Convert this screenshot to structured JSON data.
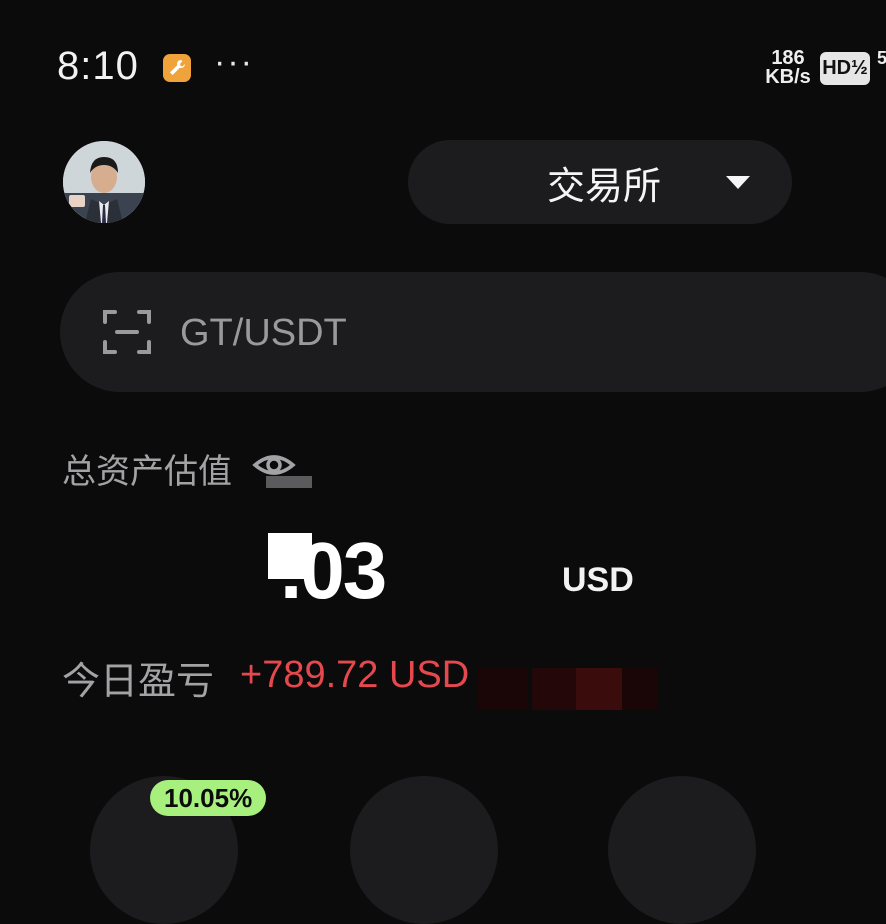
{
  "status_bar": {
    "time": "8:10",
    "more_dots": "···",
    "net_speed_value": "186",
    "net_speed_unit": "KB/s",
    "hd_badge": "HD½",
    "signal": "5"
  },
  "header": {
    "avatar_icon": "user-photo-avatar",
    "mode_label": "交易所",
    "mode_caret_icon": "caret-down-icon"
  },
  "search": {
    "scan_icon": "scan-icon",
    "placeholder": "GT/USDT"
  },
  "assets": {
    "label": "总资产估值",
    "eye_icon": "eye-icon",
    "balance_visible": ".03",
    "balance_unit": "USD"
  },
  "pnl": {
    "label": "今日盈亏",
    "value": "+789.72 USD"
  },
  "bottom": {
    "badge": "10.05%"
  },
  "colors": {
    "background": "#0b0b0c",
    "surface": "#1c1c1e",
    "negative_red": "#e5484d",
    "badge_green": "#a8f07d"
  }
}
